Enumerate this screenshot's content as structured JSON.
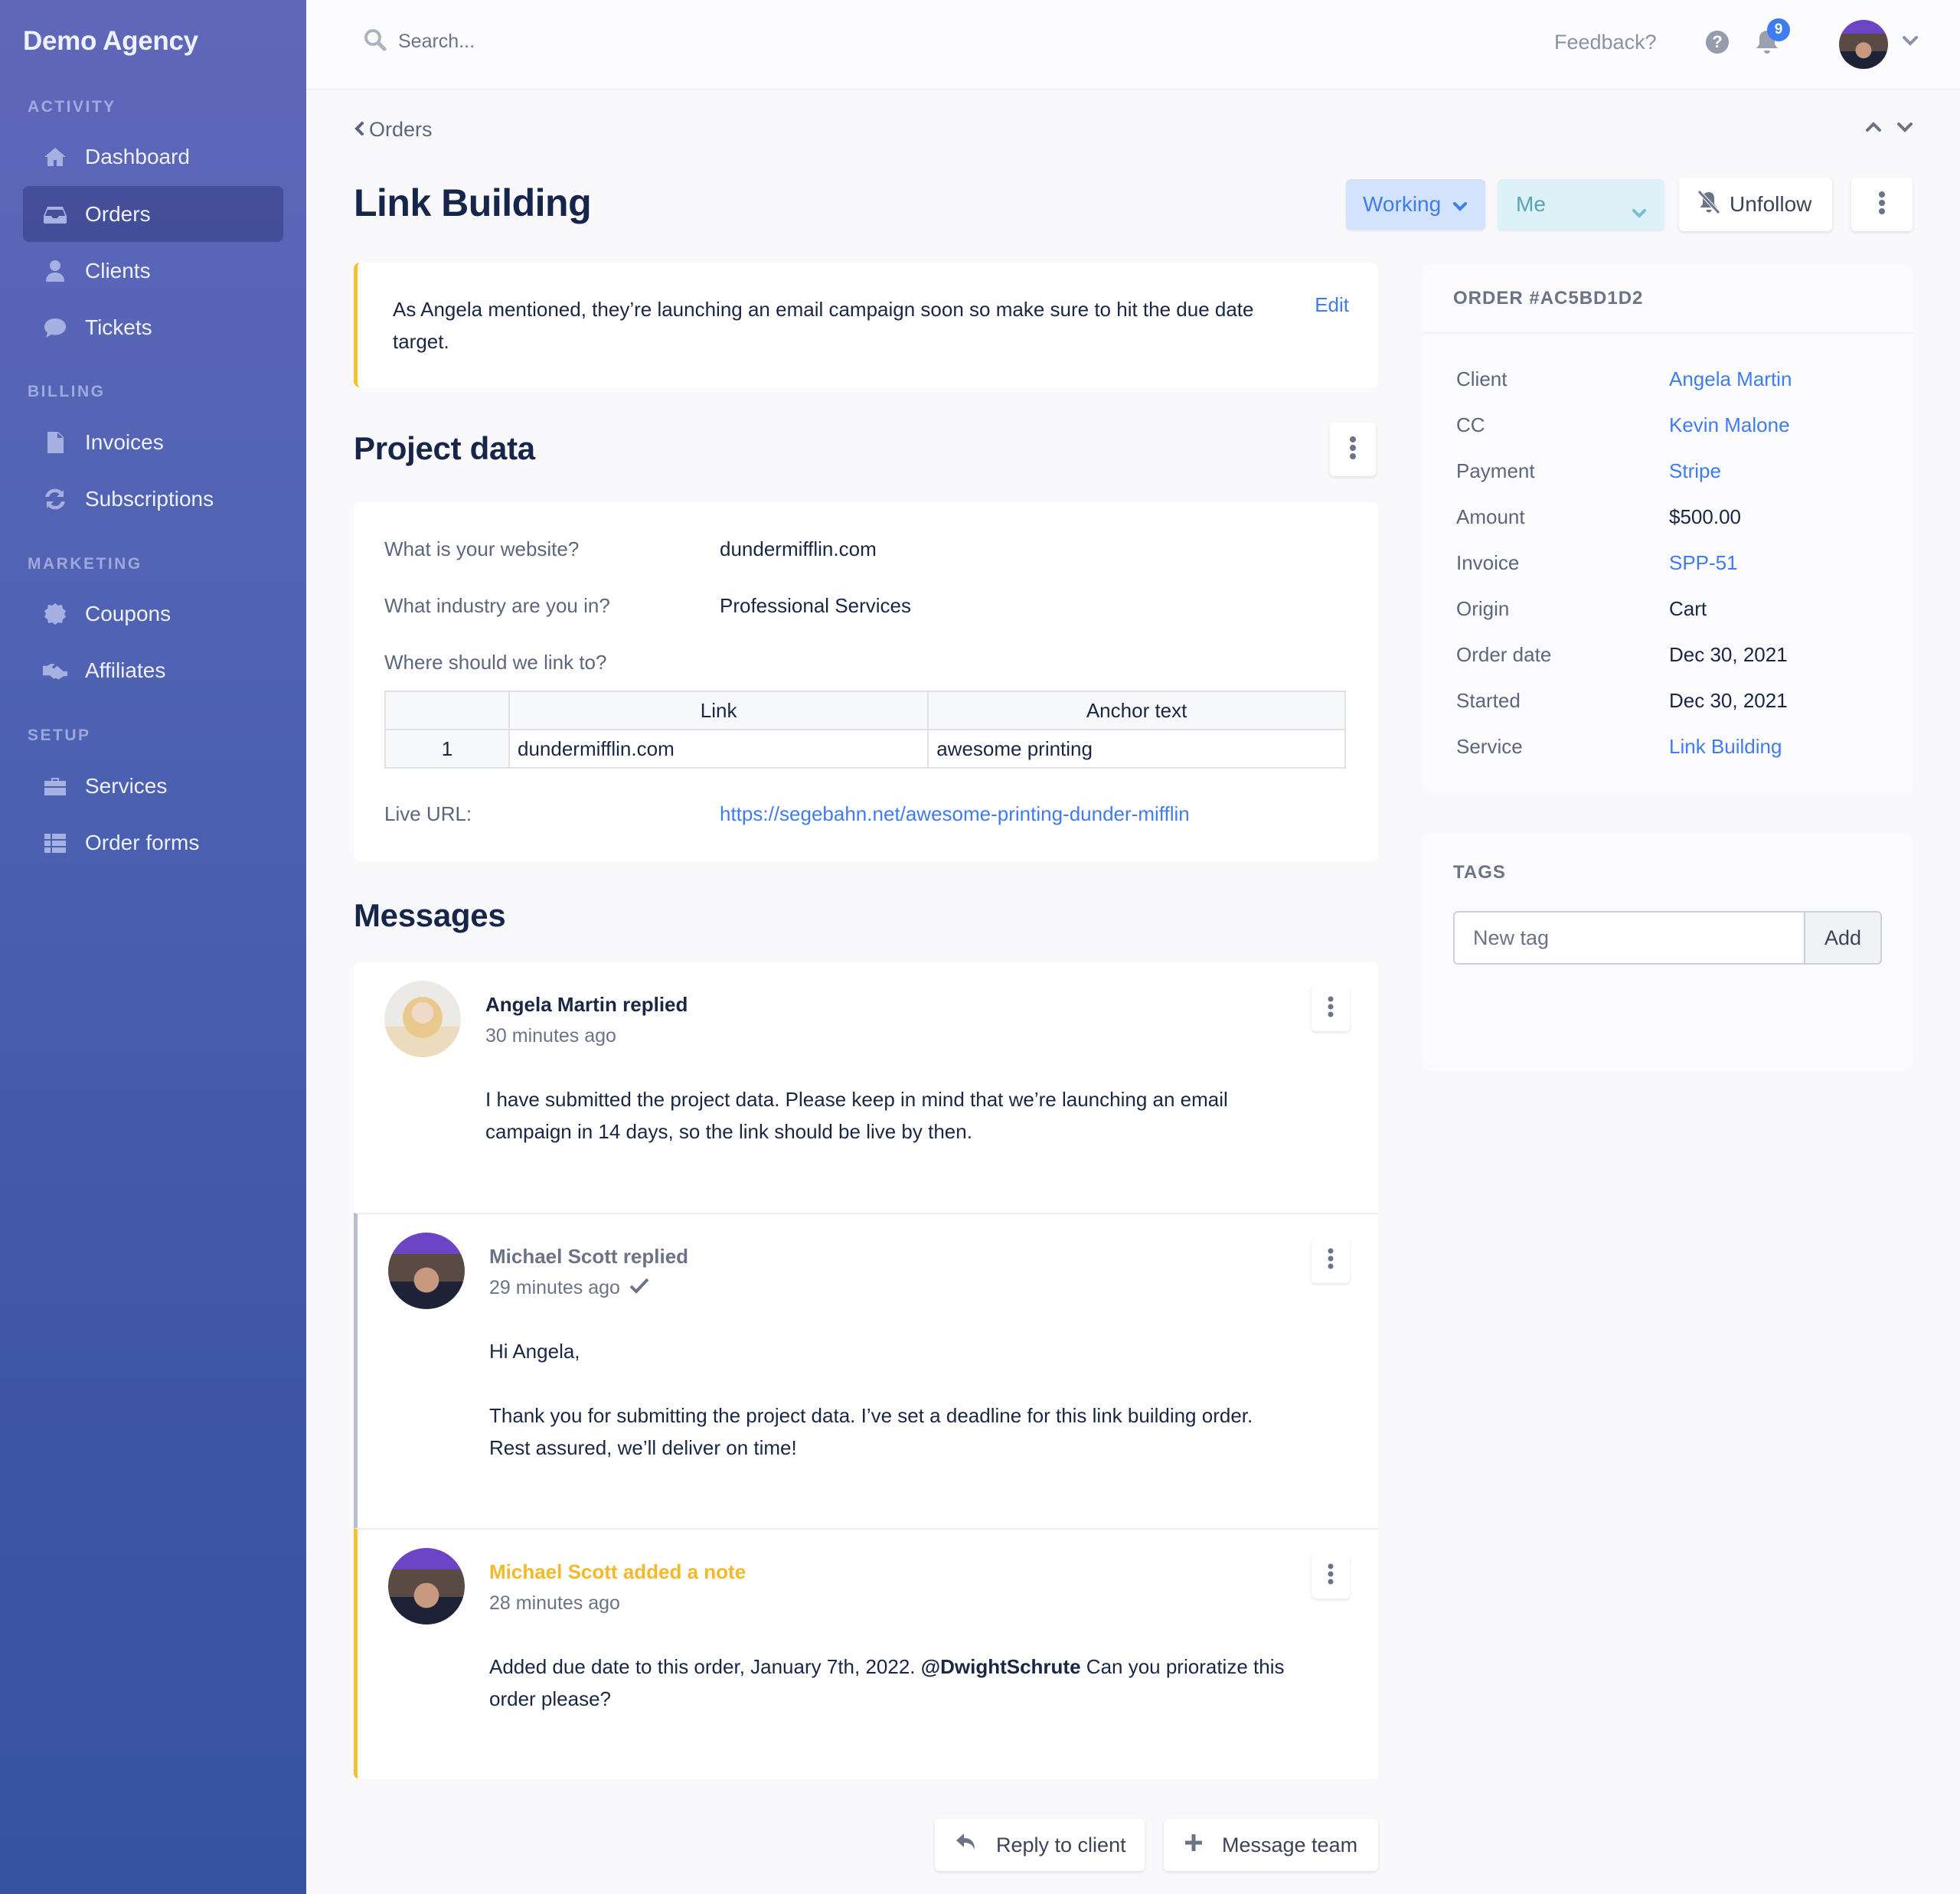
{
  "sidebar": {
    "brand": "Demo Agency",
    "sections": [
      {
        "label": "ACTIVITY",
        "items": [
          {
            "label": "Dashboard",
            "icon": "home-icon"
          },
          {
            "label": "Orders",
            "icon": "inbox-icon",
            "active": true
          },
          {
            "label": "Clients",
            "icon": "user-icon"
          },
          {
            "label": "Tickets",
            "icon": "chat-bubble-icon"
          }
        ]
      },
      {
        "label": "BILLING",
        "items": [
          {
            "label": "Invoices",
            "icon": "document-icon"
          },
          {
            "label": "Subscriptions",
            "icon": "refresh-icon"
          }
        ]
      },
      {
        "label": "MARKETING",
        "items": [
          {
            "label": "Coupons",
            "icon": "coupon-badge-icon"
          },
          {
            "label": "Affiliates",
            "icon": "handshake-icon"
          }
        ]
      },
      {
        "label": "SETUP",
        "items": [
          {
            "label": "Services",
            "icon": "toolbox-icon"
          },
          {
            "label": "Order forms",
            "icon": "table-list-icon"
          }
        ]
      }
    ]
  },
  "header": {
    "search_placeholder": "Search...",
    "feedback": "Feedback?",
    "help_glyph": "?",
    "notification_count": "9"
  },
  "breadcrumb": {
    "label": "Orders"
  },
  "page": {
    "title": "Link Building",
    "status_label": "Working",
    "assignee_label": "Me",
    "unfollow_label": "Unfollow"
  },
  "note": {
    "text": "As Angela mentioned, they’re launching an email campaign soon so make sure to hit the due date target.",
    "edit_label": "Edit"
  },
  "project_data": {
    "title": "Project data",
    "fields": [
      {
        "label": "What is your website?",
        "value": "dundermifflin.com"
      },
      {
        "label": "What industry are you in?",
        "value": "Professional Services"
      },
      {
        "label": "Where should we link to?",
        "value": ""
      }
    ],
    "table": {
      "headers": [
        "",
        "Link",
        "Anchor text"
      ],
      "rows": [
        [
          "1",
          "dundermifflin.com",
          "awesome printing"
        ]
      ]
    },
    "live_url_label": "Live URL:",
    "live_url": "https://segebahn.net/awesome-printing-dunder-mifflin"
  },
  "messages": {
    "title": "Messages",
    "items": [
      {
        "author": "Angela Martin replied",
        "time": "30 minutes ago",
        "author_color": "#1a2744",
        "paragraphs": [
          "I have submitted the project data. Please keep in mind that we’re launching an email campaign in 14 days, so the link should be live by then."
        ]
      },
      {
        "author": "Michael Scott replied",
        "time": "29 minutes ago",
        "author_color": "#6b7386",
        "seen": true,
        "paragraphs": [
          "Hi Angela,",
          "Thank you for submitting the project data. I’ve set a deadline for this link building order. Rest assured, we’ll deliver on time!"
        ]
      },
      {
        "author": "Michael Scott added a note",
        "time": "28 minutes ago",
        "author_color": "#f2b92a",
        "body_before": "Added due date to this order, January 7th, 2022. ",
        "mention": "@DwightSchrute",
        "body_after": " Can you prioratize this order please?"
      }
    ],
    "reply_label": "Reply to client",
    "team_label": "Message team"
  },
  "order_panel": {
    "heading": "ORDER #AC5BD1D2",
    "rows": [
      {
        "label": "Client",
        "value": "Angela Martin",
        "link": true
      },
      {
        "label": "CC",
        "value": "Kevin Malone",
        "link": true
      },
      {
        "label": "Payment",
        "value": "Stripe",
        "link": true
      },
      {
        "label": "Amount",
        "value": "$500.00",
        "link": false
      },
      {
        "label": "Invoice",
        "value": "SPP-51",
        "link": true
      },
      {
        "label": "Origin",
        "value": "Cart",
        "link": false
      },
      {
        "label": "Order date",
        "value": "Dec 30, 2021",
        "link": false
      },
      {
        "label": "Started",
        "value": "Dec 30, 2021",
        "link": false
      },
      {
        "label": "Service",
        "value": "Link Building",
        "link": true
      }
    ]
  },
  "tags": {
    "heading": "TAGS",
    "input_placeholder": "New tag",
    "add_label": "Add"
  },
  "colors": {
    "accent": "#3f7cee",
    "note_yellow": "#f2c230",
    "sidebar_top": "#6067b9",
    "sidebar_bottom": "#3553a0"
  }
}
